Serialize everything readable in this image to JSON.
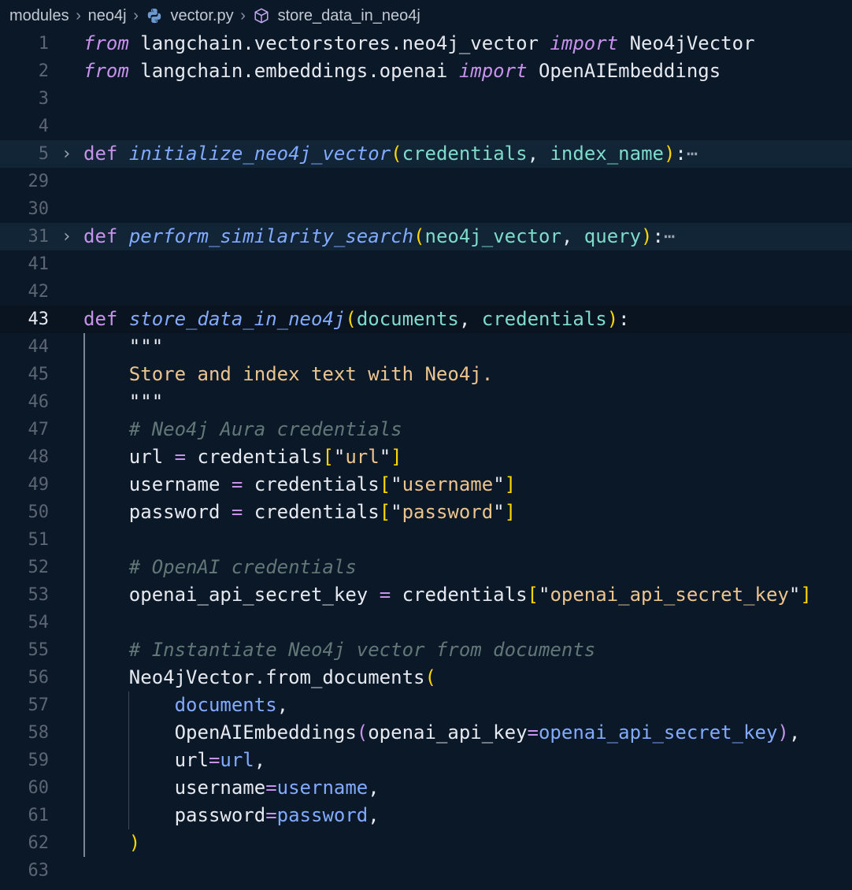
{
  "breadcrumb": {
    "items": [
      "modules",
      "neo4j",
      "vector.py",
      "store_data_in_neo4j"
    ],
    "separator": "›",
    "file_icon": "python-icon",
    "symbol_icon": "cube-icon"
  },
  "editor": {
    "active_line": "43",
    "lines": [
      {
        "num": "1",
        "tokens": [
          [
            "kwi",
            "from"
          ],
          [
            "pl",
            " langchain.vectorstores.neo4j_vector "
          ],
          [
            "kwi",
            "import"
          ],
          [
            "pl",
            " Neo4jVector"
          ]
        ]
      },
      {
        "num": "2",
        "tokens": [
          [
            "kwi",
            "from"
          ],
          [
            "pl",
            " langchain.embeddings.openai "
          ],
          [
            "kwi",
            "import"
          ],
          [
            "pl",
            " OpenAIEmbeddings"
          ]
        ]
      },
      {
        "num": "3",
        "tokens": []
      },
      {
        "num": "4",
        "tokens": []
      },
      {
        "num": "5",
        "fold": "›",
        "tokens": [
          [
            "kw",
            "def"
          ],
          [
            "pl",
            " "
          ],
          [
            "fn",
            "initialize_neo4j_vector"
          ],
          [
            "pun",
            "("
          ],
          [
            "param",
            "credentials"
          ],
          [
            "pl",
            ", "
          ],
          [
            "param",
            "index_name"
          ],
          [
            "pun",
            ")"
          ],
          [
            "pl",
            ":"
          ],
          [
            "ell",
            "⋯"
          ]
        ]
      },
      {
        "num": "29",
        "tokens": []
      },
      {
        "num": "30",
        "tokens": []
      },
      {
        "num": "31",
        "fold": "›",
        "tokens": [
          [
            "kw",
            "def"
          ],
          [
            "pl",
            " "
          ],
          [
            "fn",
            "perform_similarity_search"
          ],
          [
            "pun",
            "("
          ],
          [
            "param",
            "neo4j_vector"
          ],
          [
            "pl",
            ", "
          ],
          [
            "param",
            "query"
          ],
          [
            "pun",
            ")"
          ],
          [
            "pl",
            ":"
          ],
          [
            "ell",
            "⋯"
          ]
        ]
      },
      {
        "num": "41",
        "tokens": []
      },
      {
        "num": "42",
        "tokens": []
      },
      {
        "num": "43",
        "tokens": [
          [
            "kw",
            "def"
          ],
          [
            "pl",
            " "
          ],
          [
            "fn",
            "store_data_in_neo4j"
          ],
          [
            "pun",
            "("
          ],
          [
            "param",
            "documents"
          ],
          [
            "pl",
            ", "
          ],
          [
            "param",
            "credentials"
          ],
          [
            "pun",
            ")"
          ],
          [
            "pl",
            ":"
          ]
        ]
      },
      {
        "num": "44",
        "tokens": [
          [
            "pl",
            "    "
          ],
          [
            "pl",
            "\"\"\""
          ]
        ]
      },
      {
        "num": "45",
        "tokens": [
          [
            "pl",
            "    "
          ],
          [
            "str",
            "Store and index text with Neo4j."
          ]
        ]
      },
      {
        "num": "46",
        "tokens": [
          [
            "pl",
            "    "
          ],
          [
            "pl",
            "\"\"\""
          ]
        ]
      },
      {
        "num": "47",
        "tokens": [
          [
            "pl",
            "    "
          ],
          [
            "cmt",
            "# Neo4j Aura credentials"
          ]
        ]
      },
      {
        "num": "48",
        "tokens": [
          [
            "pl",
            "    url "
          ],
          [
            "op",
            "="
          ],
          [
            "pl",
            " credentials"
          ],
          [
            "pun",
            "["
          ],
          [
            "pl",
            "\""
          ],
          [
            "str",
            "url"
          ],
          [
            "pl",
            "\""
          ],
          [
            "pun",
            "]"
          ]
        ]
      },
      {
        "num": "49",
        "tokens": [
          [
            "pl",
            "    username "
          ],
          [
            "op",
            "="
          ],
          [
            "pl",
            " credentials"
          ],
          [
            "pun",
            "["
          ],
          [
            "pl",
            "\""
          ],
          [
            "str",
            "username"
          ],
          [
            "pl",
            "\""
          ],
          [
            "pun",
            "]"
          ]
        ]
      },
      {
        "num": "50",
        "tokens": [
          [
            "pl",
            "    password "
          ],
          [
            "op",
            "="
          ],
          [
            "pl",
            " credentials"
          ],
          [
            "pun",
            "["
          ],
          [
            "pl",
            "\""
          ],
          [
            "str",
            "password"
          ],
          [
            "pl",
            "\""
          ],
          [
            "pun",
            "]"
          ]
        ]
      },
      {
        "num": "51",
        "tokens": []
      },
      {
        "num": "52",
        "tokens": [
          [
            "pl",
            "    "
          ],
          [
            "cmt",
            "# OpenAI credentials"
          ]
        ]
      },
      {
        "num": "53",
        "tokens": [
          [
            "pl",
            "    openai_api_secret_key "
          ],
          [
            "op",
            "="
          ],
          [
            "pl",
            " credentials"
          ],
          [
            "pun",
            "["
          ],
          [
            "pl",
            "\""
          ],
          [
            "str",
            "openai_api_secret_key"
          ],
          [
            "pl",
            "\""
          ],
          [
            "pun",
            "]"
          ]
        ]
      },
      {
        "num": "54",
        "tokens": []
      },
      {
        "num": "55",
        "tokens": [
          [
            "pl",
            "    "
          ],
          [
            "cmt",
            "# Instantiate Neo4j vector from documents"
          ]
        ]
      },
      {
        "num": "56",
        "tokens": [
          [
            "pl",
            "    Neo4jVector.from_documents"
          ],
          [
            "pun",
            "("
          ]
        ]
      },
      {
        "num": "57",
        "tokens": [
          [
            "pl",
            "        "
          ],
          [
            "var",
            "documents"
          ],
          [
            "pl",
            ","
          ]
        ]
      },
      {
        "num": "58",
        "tokens": [
          [
            "pl",
            "        OpenAIEmbeddings"
          ],
          [
            "kw",
            "("
          ],
          [
            "pl",
            "openai_api_key"
          ],
          [
            "op",
            "="
          ],
          [
            "var",
            "openai_api_secret_key"
          ],
          [
            "kw",
            ")"
          ],
          [
            "pl",
            ","
          ]
        ]
      },
      {
        "num": "59",
        "tokens": [
          [
            "pl",
            "        url"
          ],
          [
            "op",
            "="
          ],
          [
            "var",
            "url"
          ],
          [
            "pl",
            ","
          ]
        ]
      },
      {
        "num": "60",
        "tokens": [
          [
            "pl",
            "        username"
          ],
          [
            "op",
            "="
          ],
          [
            "var",
            "username"
          ],
          [
            "pl",
            ","
          ]
        ]
      },
      {
        "num": "61",
        "tokens": [
          [
            "pl",
            "        password"
          ],
          [
            "op",
            "="
          ],
          [
            "var",
            "password"
          ],
          [
            "pl",
            ","
          ]
        ]
      },
      {
        "num": "62",
        "tokens": [
          [
            "pl",
            "    "
          ],
          [
            "pun",
            ")"
          ]
        ]
      },
      {
        "num": "63",
        "tokens": []
      }
    ]
  }
}
